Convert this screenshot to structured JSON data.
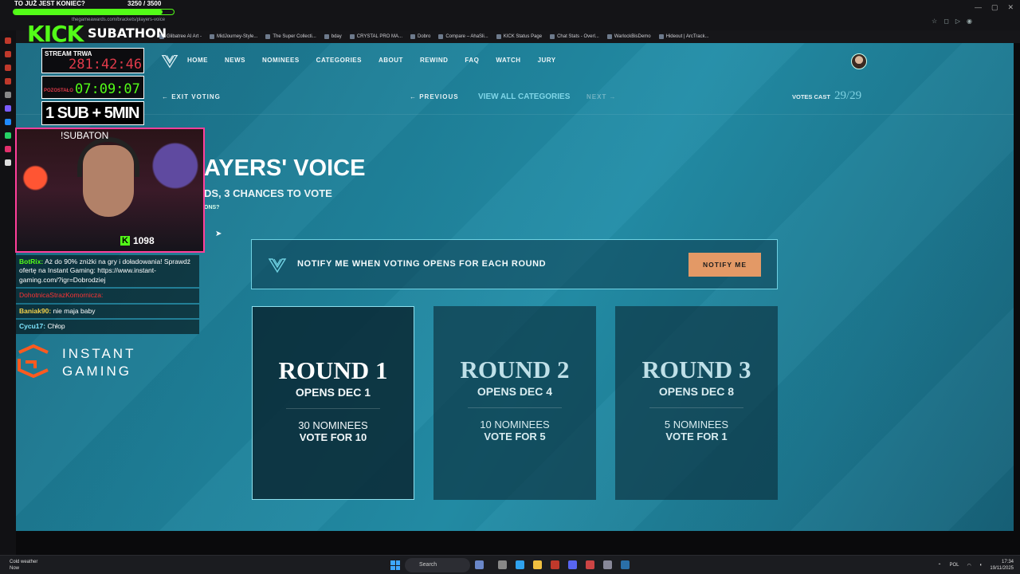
{
  "site": {
    "nav": [
      "HOME",
      "NEWS",
      "NOMINEES",
      "CATEGORIES",
      "ABOUT",
      "REWIND",
      "FAQ",
      "WATCH",
      "JURY"
    ],
    "exit_voting": "← EXIT VOTING",
    "previous": "← PREVIOUS",
    "view_all": "VIEW ALL CATEGORIES",
    "next": "NEXT →",
    "votes_cast_label": "VOTES CAST",
    "votes_cast_value": "29/29",
    "hero_title": "AYERS' VOICE",
    "hero_sub": "DS, 3 CHANCES TO VOTE",
    "hero_small": "ONS?",
    "notify_text": "NOTIFY ME WHEN VOTING OPENS FOR EACH ROUND",
    "notify_button": "NOTIFY ME",
    "rounds": [
      {
        "title": "ROUND 1",
        "opens": "OPENS DEC 1",
        "nominees": "30 NOMINEES",
        "vote_for": "VOTE FOR 10"
      },
      {
        "title": "ROUND 2",
        "opens": "OPENS DEC 4",
        "nominees": "10 NOMINEES",
        "vote_for": "VOTE FOR 5"
      },
      {
        "title": "ROUND 3",
        "opens": "OPENS DEC 8",
        "nominees": "5 NOMINEES",
        "vote_for": "VOTE FOR 1"
      }
    ]
  },
  "browser": {
    "url": "thegameawards.com/brackets/players-voice",
    "bookmarks": [
      "Glibatree AI Art -",
      "MidJourney-Style...",
      "The Super Collecti...",
      "bday",
      "CRYSTAL PRO MA...",
      "Dobro",
      "Compare – AhaSli...",
      "KICK Status Page",
      "Chat Stats - Overl...",
      "WarlockBisDemo",
      "Hideout | ArcTrack..."
    ]
  },
  "overlay": {
    "top_line": "TO JUŻ JEST KONIEC?",
    "top_count": "3250 / 3500",
    "progress": 0.93,
    "kick": "KICK",
    "subathon": "SUBATHON",
    "stream_label": "STREAM TRWA",
    "stream_timer": "281:42:46",
    "second_timer": "07:09:07",
    "second_label": "POZOSTAŁO",
    "sub_rule": "1 SUB + 5MIN",
    "cam_label": "!SUBATON",
    "viewer_count": "1098",
    "chat": [
      {
        "name": "BotRix:",
        "text": " Aż do 90% zniżki na gry i doładowania! Sprawdź ofertę na Instant Gaming: https://www.instant-gaming.com/?igr=Dobrodziej"
      },
      {
        "name": "DohotnicaStrazKomornicza:",
        "text": ""
      },
      {
        "name": "Baniak90:",
        "text": " nie maja baby"
      },
      {
        "name": "Cycu17:",
        "text": " Chłop"
      }
    ],
    "sponsor_line1": "INSTANT",
    "sponsor_line2": "GAMING"
  },
  "taskbar": {
    "weather": "Cold weather",
    "weather_sub": "Now",
    "search": "Search",
    "lang": "POL",
    "time": "17:34",
    "date": "19/11/2025"
  }
}
